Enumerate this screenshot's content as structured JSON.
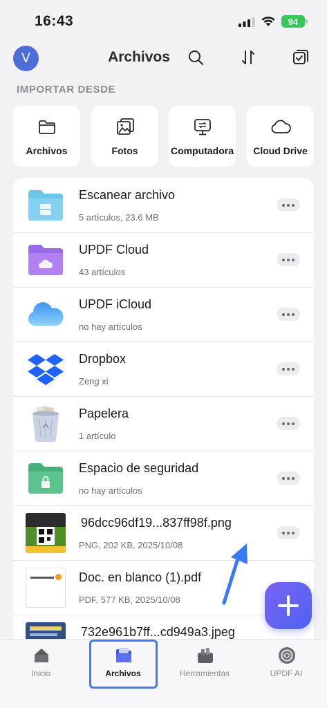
{
  "status_bar": {
    "time": "16:43",
    "battery": "94"
  },
  "header": {
    "avatar_letter": "V",
    "title": "Archivos"
  },
  "import_section": {
    "label": "IMPORTAR DESDE",
    "items": [
      {
        "label": "Archivos",
        "icon": "folder-icon"
      },
      {
        "label": "Fotos",
        "icon": "photos-icon"
      },
      {
        "label": "Computadora",
        "icon": "computer-icon"
      },
      {
        "label": "Cloud Drive",
        "icon": "cloud-icon"
      }
    ]
  },
  "files": [
    {
      "name": "Escanear archivo",
      "meta": "5 artículos, 23.6 MB",
      "icon": "scan-folder-icon"
    },
    {
      "name": "UPDF Cloud",
      "meta": "43 artículos",
      "icon": "cloud-folder-icon"
    },
    {
      "name": "UPDF iCloud",
      "meta": "no hay artículos",
      "icon": "icloud-icon"
    },
    {
      "name": "Dropbox",
      "meta": "Zeng xi",
      "icon": "dropbox-icon"
    },
    {
      "name": "Papelera",
      "meta": "1 artículo",
      "icon": "trash-icon"
    },
    {
      "name": "Espacio de seguridad",
      "meta": "no hay artículos",
      "icon": "secure-folder-icon"
    },
    {
      "name": "96dcc96df19...837ff98f.png",
      "meta": "PNG, 202 KB, 2025/10/08",
      "icon": "png-thumbnail"
    },
    {
      "name": "Doc. en blanco (1).pdf",
      "meta": "PDF, 577 KB, 2025/10/08",
      "icon": "pdf-thumbnail"
    },
    {
      "name": "732e961b7ff...cd949a3.jpeg",
      "meta": "",
      "icon": "jpeg-thumbnail"
    }
  ],
  "tabs": [
    {
      "label": "Inicio",
      "icon": "home-icon"
    },
    {
      "label": "Archivos",
      "icon": "files-tab-icon",
      "active": true
    },
    {
      "label": "Herramientas",
      "icon": "tools-icon"
    },
    {
      "label": "UPDF AI",
      "icon": "ai-icon"
    }
  ],
  "colors": {
    "accent": "#5865f2",
    "highlight": "#3a79f5",
    "battery": "#34c759"
  }
}
